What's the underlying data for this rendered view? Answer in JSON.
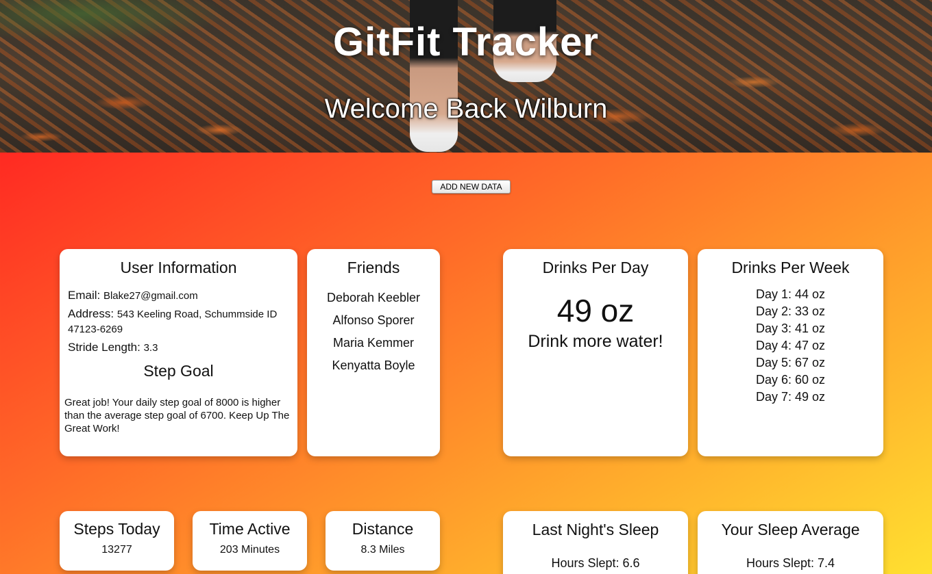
{
  "header": {
    "title": "GitFit Tracker",
    "welcome": "Welcome Back Wilburn"
  },
  "actions": {
    "add_data_label": "ADD NEW DATA"
  },
  "user_info": {
    "title": "User Information",
    "email_label": "Email:",
    "email": "Blake27@gmail.com",
    "address_label": "Address:",
    "address": "543 Keeling Road, Schummside ID 47123-6269",
    "stride_label": "Stride Length:",
    "stride": "3.3",
    "step_goal_title": "Step Goal",
    "step_goal_text": "Great job! Your daily step goal of 8000 is higher than the average step goal of 6700. Keep Up The Great Work!"
  },
  "friends": {
    "title": "Friends",
    "names": [
      "Deborah Keebler",
      "Alfonso Sporer",
      "Maria Kemmer",
      "Kenyatta Boyle"
    ]
  },
  "drinks_per_day": {
    "title": "Drinks Per Day",
    "amount": "49 oz",
    "message": "Drink more water!"
  },
  "drinks_per_week": {
    "title": "Drinks Per Week",
    "days": [
      "Day 1: 44 oz",
      "Day 2: 33 oz",
      "Day 3: 41 oz",
      "Day 4: 47 oz",
      "Day 5: 67 oz",
      "Day 6: 60 oz",
      "Day 7: 49 oz"
    ]
  },
  "activity": {
    "steps_title": "Steps Today",
    "steps_value": "13277",
    "active_title": "Time Active",
    "active_value": "203 Minutes",
    "distance_title": "Distance",
    "distance_value": "8.3 Miles"
  },
  "sleep": {
    "last_title": "Last Night's Sleep",
    "last_value": "Hours Slept: 6.6",
    "avg_title": "Your Sleep Average",
    "avg_value": "Hours Slept: 7.4"
  }
}
